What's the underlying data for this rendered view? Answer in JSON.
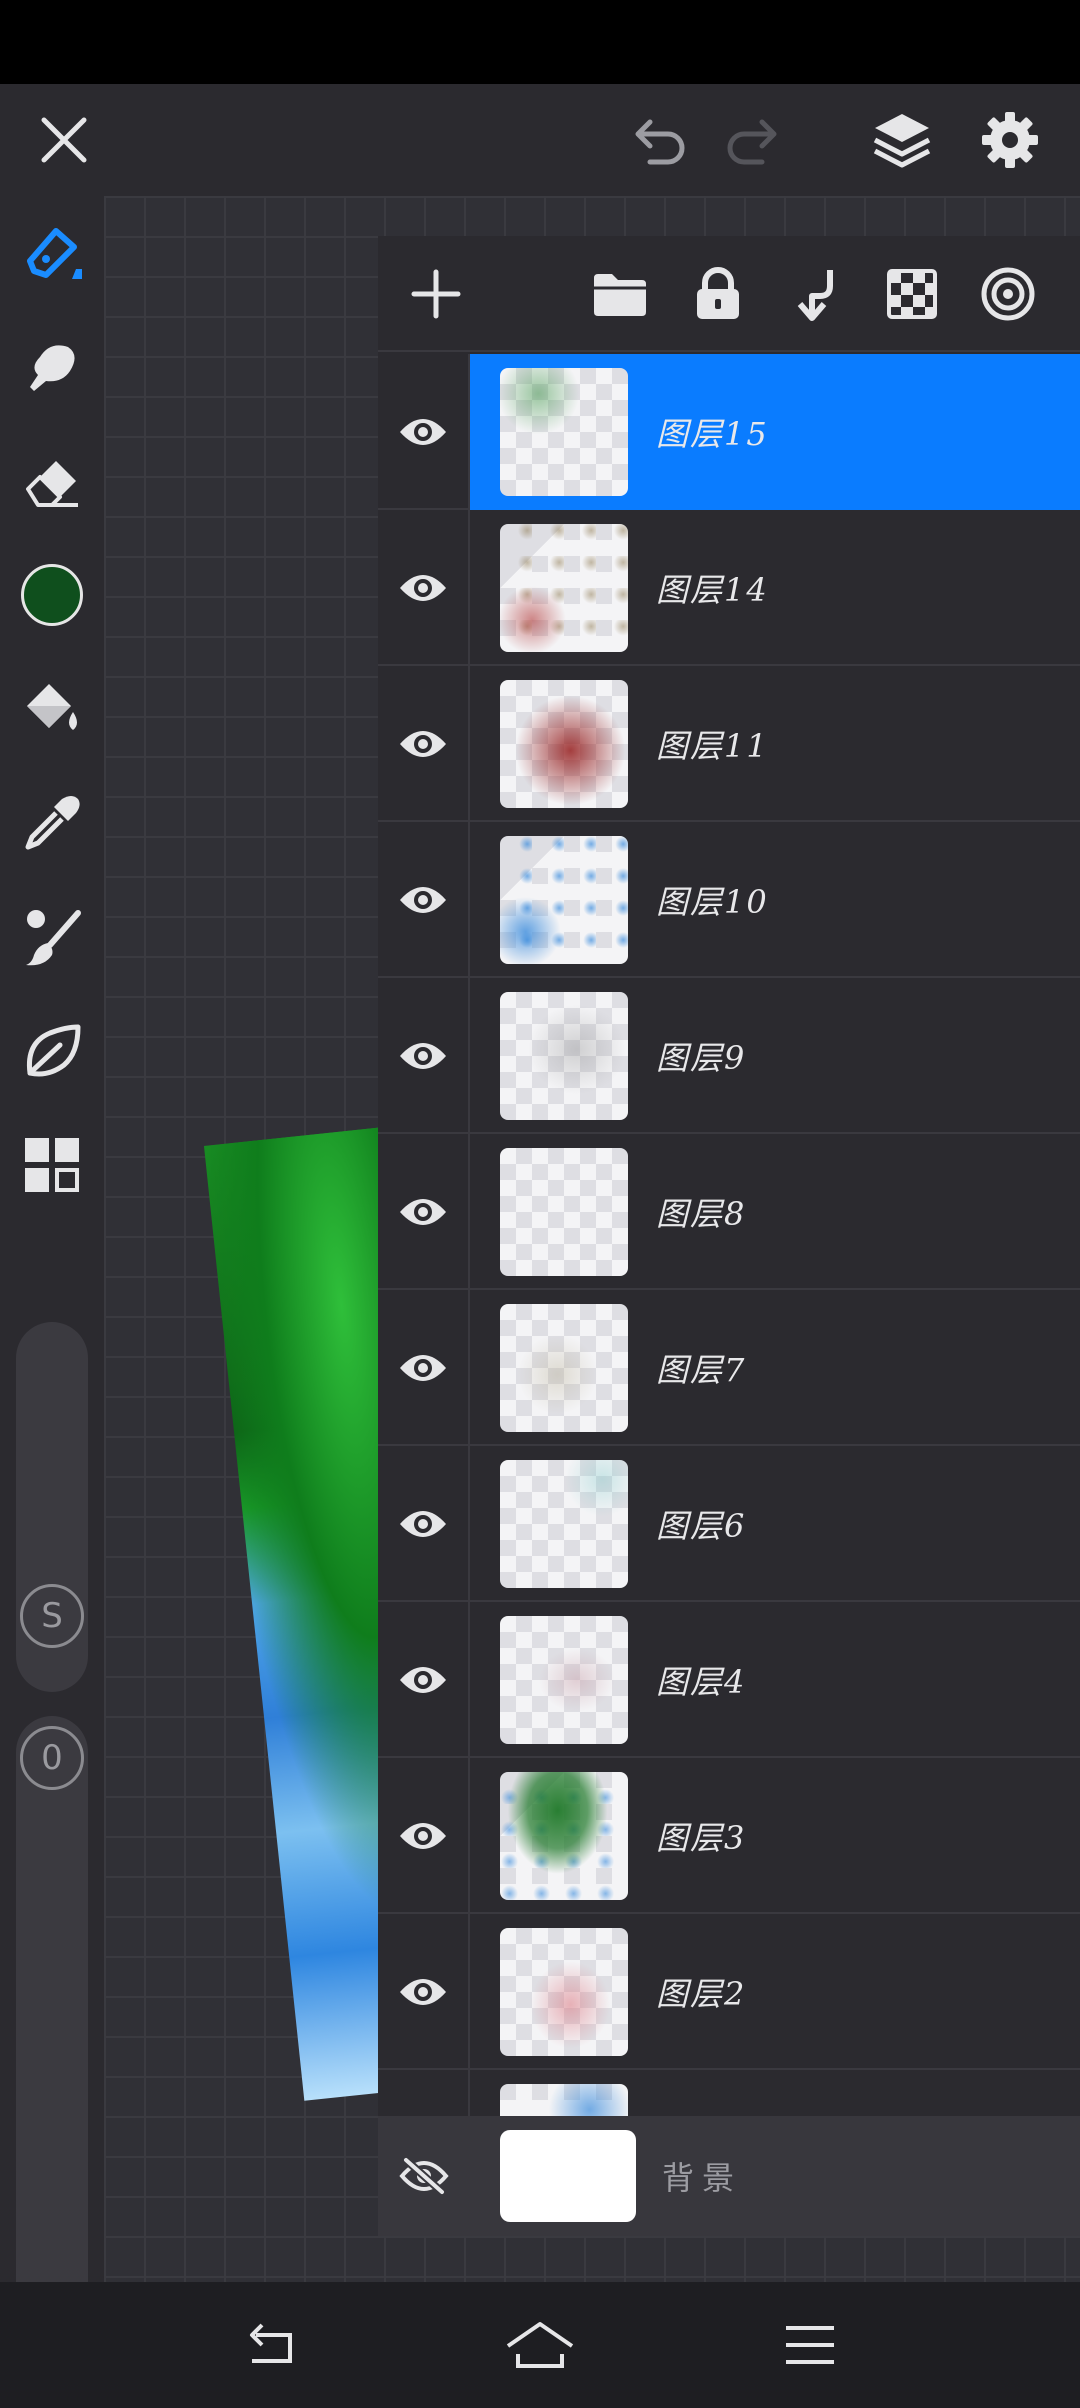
{
  "app": {
    "accent_color": "#0a7cff",
    "toolbar_bg": "#2b2a2f"
  },
  "top_toolbar": {
    "close_icon": "close-icon",
    "undo_icon": "undo-icon",
    "redo_icon": "redo-icon",
    "layers_icon": "layers-icon",
    "settings_icon": "gear-icon"
  },
  "left_toolbar": {
    "tools": [
      "brush-icon",
      "smudge-icon",
      "eraser-icon",
      "color-swatch",
      "fill-bucket-icon",
      "eyedropper-icon",
      "blend-brush-icon",
      "leaf-icon",
      "grid-icon"
    ],
    "current_color": "#0f4f1d",
    "size_slider_label": "S",
    "opacity_slider_label": "0"
  },
  "layers_panel": {
    "toolbar": [
      "add-layer-icon",
      "folder-icon",
      "lock-icon",
      "merge-down-icon",
      "transparency-icon",
      "target-icon"
    ],
    "layers": [
      {
        "name": "图层15",
        "visible": true,
        "selected": true
      },
      {
        "name": "图层14",
        "visible": true,
        "selected": false
      },
      {
        "name": "图层11",
        "visible": true,
        "selected": false
      },
      {
        "name": "图层10",
        "visible": true,
        "selected": false
      },
      {
        "name": "图层9",
        "visible": true,
        "selected": false
      },
      {
        "name": "图层8",
        "visible": true,
        "selected": false
      },
      {
        "name": "图层7",
        "visible": true,
        "selected": false
      },
      {
        "name": "图层6",
        "visible": true,
        "selected": false
      },
      {
        "name": "图层4",
        "visible": true,
        "selected": false
      },
      {
        "name": "图层3",
        "visible": true,
        "selected": false
      },
      {
        "name": "图层2",
        "visible": true,
        "selected": false
      }
    ],
    "background_layer": {
      "name": "背景",
      "visible": false
    }
  },
  "nav_bar": {
    "back_icon": "back-icon",
    "home_icon": "home-icon",
    "menu_icon": "menu-icon"
  }
}
